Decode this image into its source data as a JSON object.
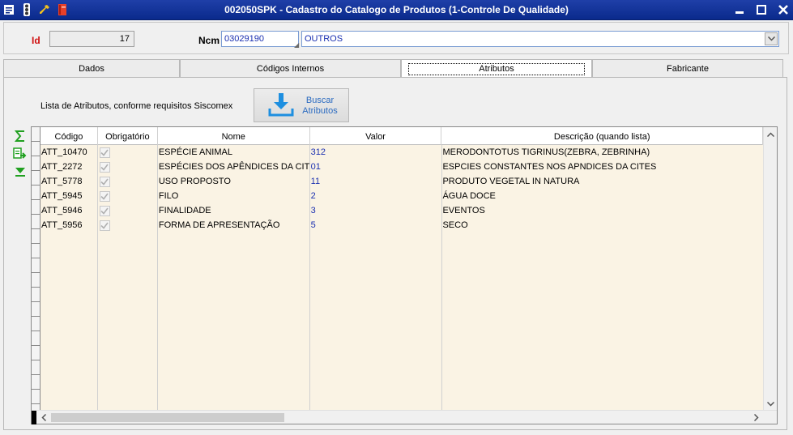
{
  "window": {
    "title": "002050SPK - Cadastro do Catalogo de Produtos (1-Controle De Qualidade)"
  },
  "titlebar_icons": [
    "menu-icon",
    "traffic-light-icon",
    "wrench-icon",
    "book-icon"
  ],
  "header": {
    "id_label": "Id",
    "id_value": "17",
    "ncm_label": "Ncm",
    "ncm_code": "03029190",
    "ncm_description": "OUTROS"
  },
  "tabs": [
    {
      "label": "Dados"
    },
    {
      "label": "Códigos Internos"
    },
    {
      "label": "Atributos",
      "active": true
    },
    {
      "label": "Fabricante"
    }
  ],
  "atributos": {
    "caption": "Lista de Atributos, conforme requisitos Siscomex",
    "buscar_line1": "Buscar",
    "buscar_line2": "Atributos"
  },
  "grid": {
    "columns": [
      "Código",
      "Obrigatório",
      "Nome",
      "Valor",
      "Descrição (quando lista)"
    ],
    "rows": [
      {
        "codigo": "ATT_10470",
        "obrigatorio": true,
        "nome": "ESPÉCIE ANIMAL",
        "valor": "312",
        "descricao": "MERODONTOTUS TIGRINUS(ZEBRA, ZEBRINHA)"
      },
      {
        "codigo": "ATT_2272",
        "obrigatorio": true,
        "nome": "ESPÉCIES DOS APÊNDICES DA CITES",
        "valor": "01",
        "descricao": "ESPCIES CONSTANTES NOS APNDICES DA CITES"
      },
      {
        "codigo": "ATT_5778",
        "obrigatorio": true,
        "nome": "USO PROPOSTO",
        "valor": "11",
        "descricao": "PRODUTO VEGETAL IN NATURA"
      },
      {
        "codigo": "ATT_5945",
        "obrigatorio": true,
        "nome": "FILO",
        "valor": "2",
        "descricao": "ÁGUA DOCE"
      },
      {
        "codigo": "ATT_5946",
        "obrigatorio": true,
        "nome": "FINALIDADE",
        "valor": "3",
        "descricao": "EVENTOS"
      },
      {
        "codigo": "ATT_5956",
        "obrigatorio": true,
        "nome": "FORMA DE APRESENTAÇÃO",
        "valor": "5",
        "descricao": "SECO"
      }
    ]
  }
}
